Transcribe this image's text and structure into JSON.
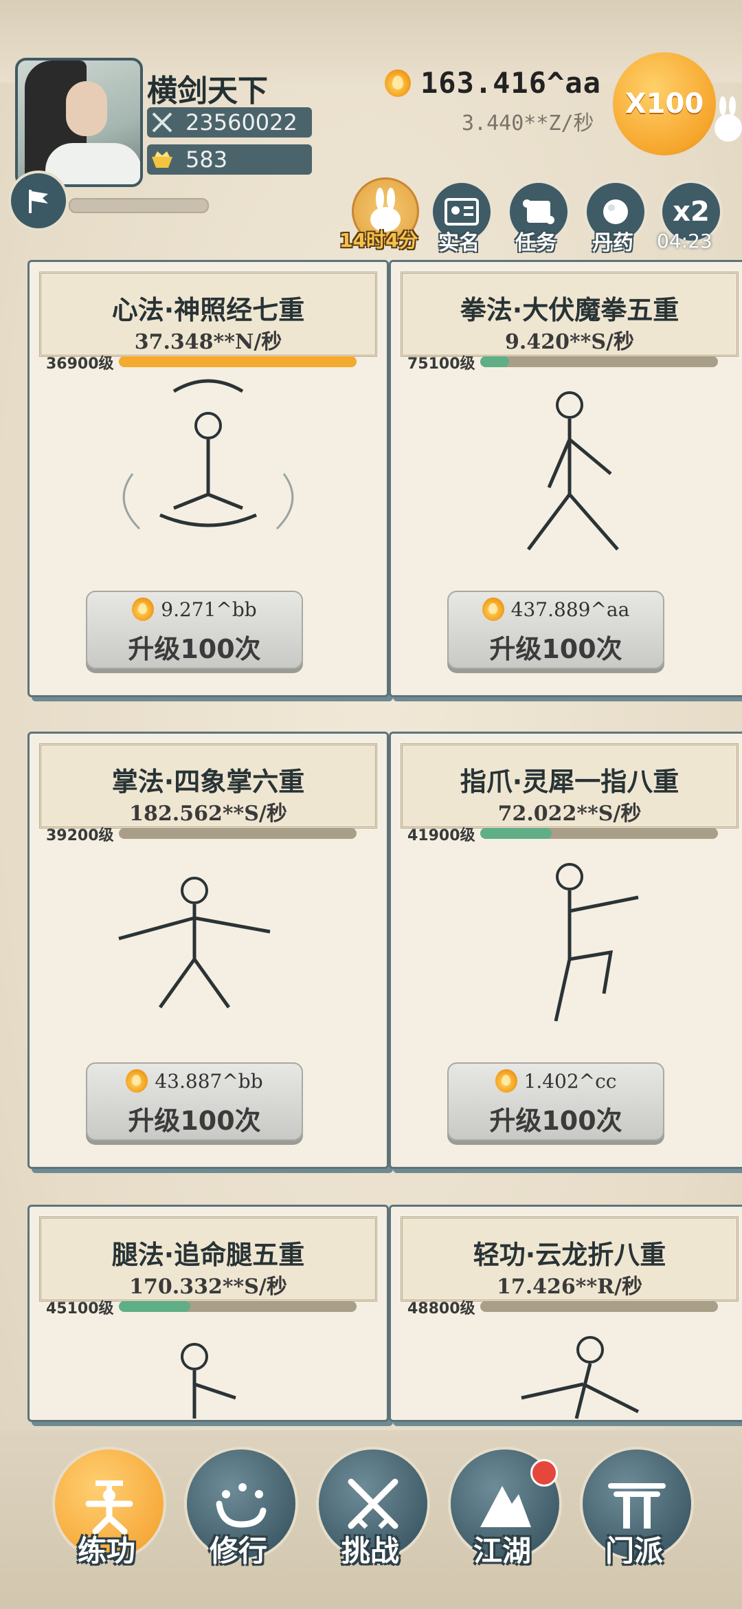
{
  "player": {
    "name": "横剑天下",
    "power": "23560022",
    "ingots": "583"
  },
  "currency": {
    "gold": "163.416^aa",
    "rate": "3.440**Z/秒",
    "multiplier": "X100"
  },
  "top_bar": {
    "event_timer": "14时4分",
    "realname_label": "实名",
    "task_label": "任务",
    "pill_label": "丹药",
    "x2_label": "x2",
    "x2_timer": "04:23"
  },
  "cards": [
    {
      "title": "心法·神照经七重",
      "rate": "37.348**N/秒",
      "level": "36900级",
      "progress": 1.0,
      "bar_color": "#f4a92f",
      "cost": "9.271^bb",
      "upgrade": "升级100次"
    },
    {
      "title": "拳法·大伏魔拳五重",
      "rate": "9.420**S/秒",
      "level": "75100级",
      "progress": 0.12,
      "bar_color": "#5fae86",
      "cost": "437.889^aa",
      "upgrade": "升级100次"
    },
    {
      "title": "掌法·四象掌六重",
      "rate": "182.562**S/秒",
      "level": "39200级",
      "progress": 0.0,
      "bar_color": "#5fae86",
      "cost": "43.887^bb",
      "upgrade": "升级100次"
    },
    {
      "title": "指爪·灵犀一指八重",
      "rate": "72.022**S/秒",
      "level": "41900级",
      "progress": 0.3,
      "bar_color": "#5fae86",
      "cost": "1.402^cc",
      "upgrade": "升级100次"
    },
    {
      "title": "腿法·追命腿五重",
      "rate": "170.332**S/秒",
      "level": "45100级",
      "progress": 0.3,
      "bar_color": "#5fae86",
      "cost": "",
      "upgrade": ""
    },
    {
      "title": "轻功·云龙折八重",
      "rate": "17.426**R/秒",
      "level": "48800级",
      "progress": 0.0,
      "bar_color": "#5fae86",
      "cost": "",
      "upgrade": ""
    }
  ],
  "nav": [
    {
      "label": "练功",
      "icon": "martial-figure-icon",
      "active": true
    },
    {
      "label": "修行",
      "icon": "heart-char-icon",
      "active": false
    },
    {
      "label": "挑战",
      "icon": "crossed-swords-icon",
      "active": false
    },
    {
      "label": "江湖",
      "icon": "mountain-icon",
      "active": false,
      "badge": true
    },
    {
      "label": "门派",
      "icon": "gate-icon",
      "active": false
    }
  ]
}
